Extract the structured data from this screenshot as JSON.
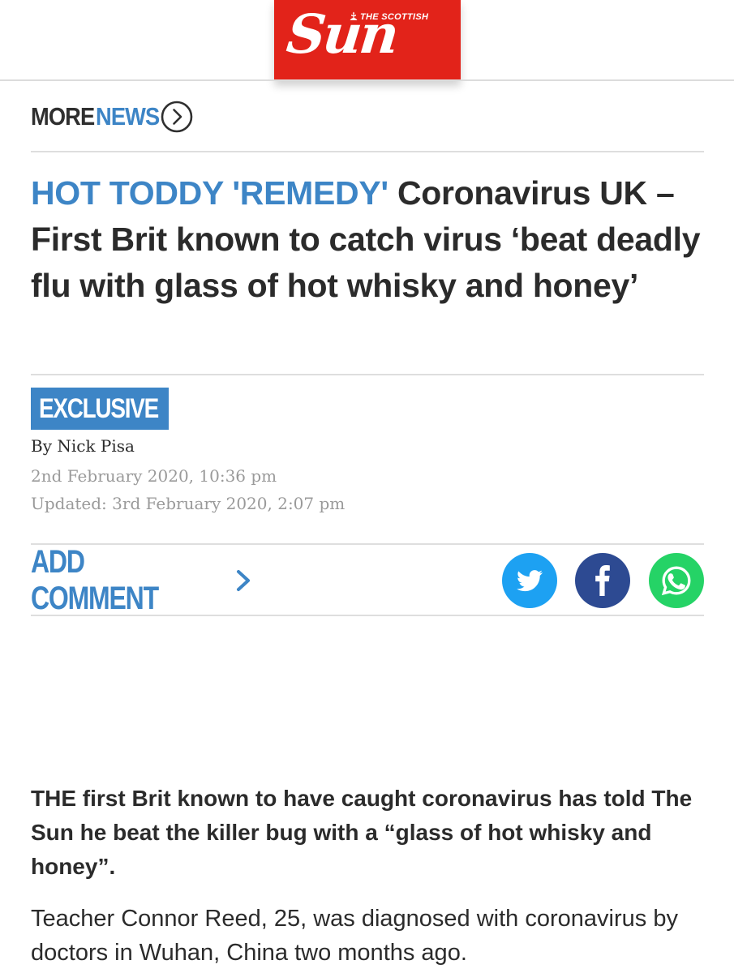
{
  "masthead": {
    "logo_small": "THE SCOTTISH",
    "logo_main": "Sun",
    "brand_color": "#e2231a"
  },
  "more_news": {
    "word1": "MORE",
    "word2": "NEWS",
    "icon": "chevron-right-circle-icon"
  },
  "article": {
    "kicker": "HOT TODDY 'REMEDY'",
    "headline": "Coronavirus UK – First Brit known to catch virus ‘beat deadly flu with glass of hot whisky and honey’",
    "badge": "EXCLUSIVE",
    "byline_prefix": "By",
    "author": "Nick Pisa",
    "published": "2nd February 2020, 10:36 pm",
    "updated": "Updated: 3rd February 2020, 2:07 pm",
    "lede": "THE first Brit known to have caught coronavirus has told The Sun he beat the killer bug with a “glass of hot whisky and honey”.",
    "paragraph1": "Teacher Connor Reed, 25, was diagnosed with coronavirus by doctors in Wuhan, China two months ago."
  },
  "comments": {
    "label": "ADD COMMENT",
    "icon": "chevron-right-icon"
  },
  "share": [
    {
      "name": "twitter",
      "icon": "twitter-bird-icon",
      "color": "#1da1f2"
    },
    {
      "name": "facebook",
      "icon": "facebook-f-icon",
      "color": "#2d4a92"
    },
    {
      "name": "whatsapp",
      "icon": "whatsapp-phone-icon",
      "color": "#25d366"
    }
  ],
  "colors": {
    "accent": "#3d85c6",
    "text": "#2b2b2b",
    "muted": "#9a9a9a"
  }
}
